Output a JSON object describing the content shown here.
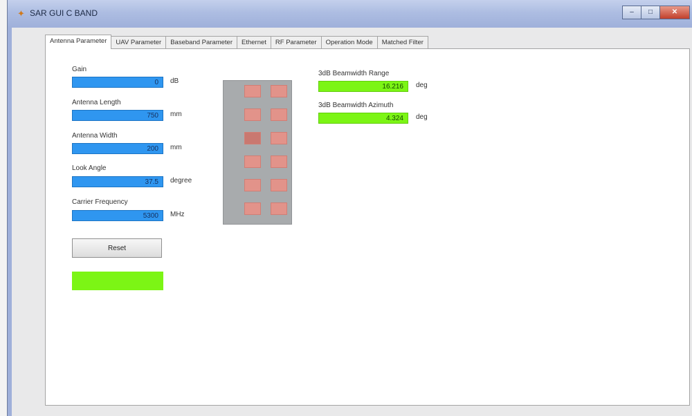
{
  "window": {
    "title": "SAR GUI C BAND"
  },
  "window_buttons": {
    "minimize": "–",
    "maximize": "□",
    "close": "✕"
  },
  "tabs": [
    {
      "label": "Antenna Parameter",
      "active": true
    },
    {
      "label": "UAV Parameter"
    },
    {
      "label": "Baseband Parameter"
    },
    {
      "label": "Ethernet"
    },
    {
      "label": "RF Parameter"
    },
    {
      "label": "Operation Mode"
    },
    {
      "label": "Matched Filter"
    }
  ],
  "antenna": {
    "gain": {
      "label": "Gain",
      "value": "0",
      "unit": "dB"
    },
    "length": {
      "label": "Antenna Length",
      "value": "750",
      "unit": "mm"
    },
    "width": {
      "label": "Antenna Width",
      "value": "200",
      "unit": "mm"
    },
    "look_angle": {
      "label": "Look Angle",
      "value": "37.5",
      "unit": "degree"
    },
    "carrier_freq": {
      "label": "Carrier Frequency",
      "value": "5300",
      "unit": "MHz"
    }
  },
  "beamwidth": {
    "range": {
      "label": "3dB Beamwidth Range",
      "value": "16.216",
      "unit": "deg"
    },
    "azimuth": {
      "label": "3dB Beamwidth Azimuth",
      "value": "4.324",
      "unit": "deg"
    }
  },
  "reset_label": "Reset",
  "colors": {
    "field_blue": "#2f96f0",
    "status_green": "#7cf515",
    "patch": "#e2938a"
  },
  "icons": {
    "app": "app-icon"
  }
}
